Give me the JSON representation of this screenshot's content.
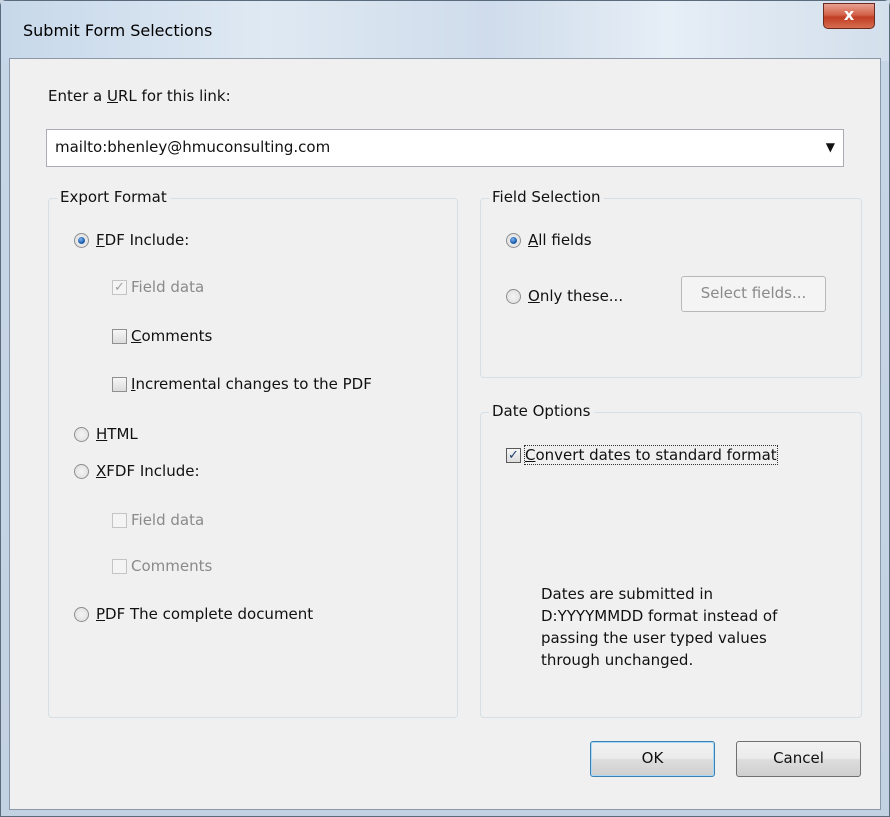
{
  "window": {
    "title": "Submit Form Selections",
    "close_glyph": "x"
  },
  "url": {
    "label_prefix": "Enter a ",
    "label_underlined": "U",
    "label_suffix": "RL for this link:",
    "value": "mailto:bhenley@hmuconsulting.com",
    "dropdown_glyph": "▼"
  },
  "export_format": {
    "title": "Export Format",
    "fdf": {
      "underlined": "F",
      "rest": "DF  Include:",
      "selected": true
    },
    "fdf_options": {
      "field_data": {
        "label": "Field data",
        "checked": true,
        "disabled": true
      },
      "comments": {
        "underlined": "C",
        "rest": "omments",
        "checked": false
      },
      "incremental": {
        "underlined": "I",
        "rest": "ncremental changes to the PDF",
        "checked": false
      }
    },
    "html": {
      "underlined": "H",
      "rest": "TML"
    },
    "xfdf": {
      "underlined": "X",
      "rest": "FDF  Include:"
    },
    "xfdf_options": {
      "field_data": {
        "label": "Field data",
        "disabled": true
      },
      "comments": {
        "label": "Comments",
        "disabled": true
      }
    },
    "pdf": {
      "underlined": "P",
      "rest": "DF  The complete document"
    }
  },
  "field_selection": {
    "title": "Field Selection",
    "all_fields": {
      "underlined": "A",
      "rest": "ll fields",
      "selected": true
    },
    "only_these": {
      "underlined": "O",
      "rest": "nly these..."
    },
    "select_fields_button": "Select fields..."
  },
  "date_options": {
    "title": "Date Options",
    "convert": {
      "underlined": "C",
      "rest": "onvert dates to standard format",
      "checked": true
    },
    "note_lines": [
      "Dates are submitted in",
      "D:YYYYMMDD format instead of",
      "passing the user typed values",
      "through unchanged."
    ]
  },
  "buttons": {
    "ok": "OK",
    "cancel": "Cancel"
  },
  "colors": {
    "accent": "#1c5fae",
    "close": "#c03e24"
  }
}
